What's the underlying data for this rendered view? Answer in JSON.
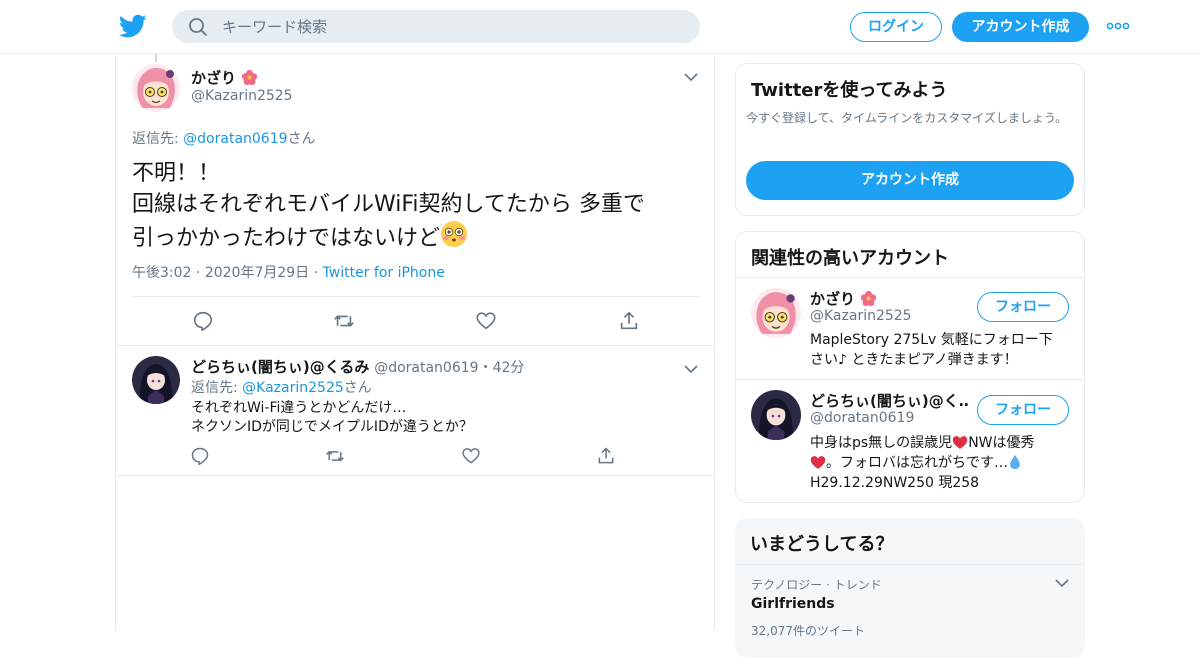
{
  "header": {
    "logo_icon": "twitter-bird-icon",
    "search_placeholder": "キーワード検索",
    "login_label": "ログイン",
    "signup_label": "アカウント作成",
    "more_icon": "more-dots-icon"
  },
  "main_tweet": {
    "name": "かざり",
    "name_emoji": "hibiscus-icon",
    "handle": "@Kazarin2525",
    "reply_prefix": "返信先: ",
    "reply_to": "@doratan0619",
    "reply_suffix": "さん",
    "text_lines": [
      "不明！！",
      "回線はそれぞれモバイルWiFi契約してたから 多重で",
      "引っかかったわけではないけど"
    ],
    "text_emoji": "flushed-face-icon",
    "time": "午後3:02",
    "date": "2020年7月29日",
    "source": "Twitter for iPhone"
  },
  "reply_tweet": {
    "name": "どらちぃ(闇ちぃ)@くるみ",
    "handle": "@doratan0619",
    "age": "42分",
    "reply_prefix": "返信先: ",
    "reply_to": "@Kazarin2525",
    "reply_suffix": "さん",
    "text_lines": [
      "それぞれWi-Fi違うとかどんだけ…",
      "ネクソンIDが同じでメイプルIDが違うとか？"
    ]
  },
  "sidebar": {
    "signup_card": {
      "title": "Twitterを使ってみよう",
      "description": "今すぐ登録して、タイムラインをカスタマイズしましょう。",
      "button": "アカウント作成"
    },
    "related": {
      "title": "関連性の高いアカウント",
      "follow_label": "フォロー",
      "accounts": [
        {
          "name": "かざり",
          "handle": "@Kazarin2525",
          "bio_lines": [
            "MapleStory 275Lv 気軽にフォロー下",
            "さい♪ ときたまピアノ弾きます！"
          ]
        },
        {
          "name": "どらちぃ(闇ちぃ)@く…",
          "handle": "@doratan0619",
          "bio_lines": [
            "中身はps無しの誤歳児",
            "NWは優秀",
            "。フォロバは忘れがちです…",
            "H29.12.29NW250 現258"
          ]
        }
      ]
    },
    "trends": {
      "title": "いまどうしてる？",
      "category": "テクノロジー · トレンド",
      "name": "Girlfriends",
      "count": "32,077件のツイート"
    }
  },
  "colors": {
    "accent": "#1da1f2",
    "link": "#1b95e0",
    "muted": "#657786",
    "border": "#e6ecf0"
  }
}
